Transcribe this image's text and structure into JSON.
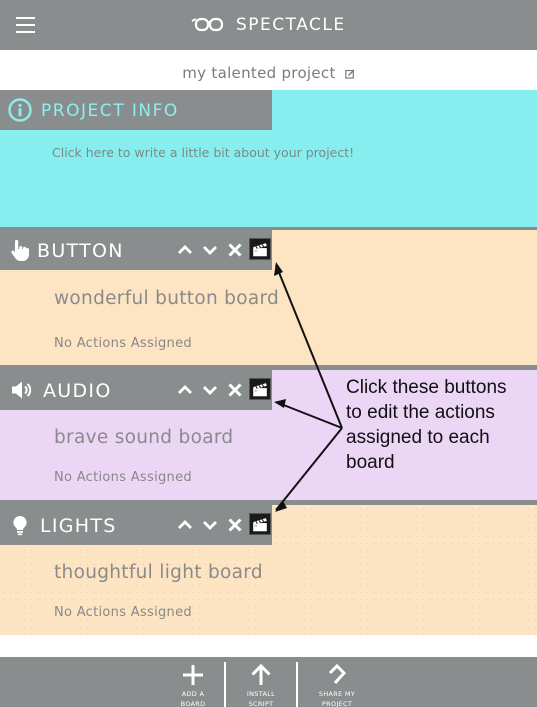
{
  "app": {
    "title": "SPECTACLE"
  },
  "project": {
    "name": "my talented project"
  },
  "info": {
    "title": "PROJECT INFO",
    "placeholder": "Click here to write a little bit about your project!"
  },
  "boards": [
    {
      "type": "BUTTON",
      "name": "wonderful button board",
      "actions": "No Actions Assigned",
      "color": "#fde4c3"
    },
    {
      "type": "AUDIO",
      "name": "brave sound board",
      "actions": "No Actions Assigned",
      "color": "#ecd6f6"
    },
    {
      "type": "LIGHTS",
      "name": "thoughtful light board",
      "actions": "No Actions Assigned",
      "color": "#fde4c3"
    }
  ],
  "annotation": "Click these buttons\nto edit the actions\nassigned to each\nboard",
  "bottom_bar": {
    "add": "ADD A\nBOARD",
    "install": "INSTALL\nSCRIPT",
    "share": "SHARE MY\nPROJECT"
  },
  "colors": {
    "header_gray": "#8a8d8e",
    "info_bg": "#86eeee",
    "button_bg": "#fde4c3",
    "audio_bg": "#ecd6f6",
    "lights_bg": "#fde4c3"
  }
}
